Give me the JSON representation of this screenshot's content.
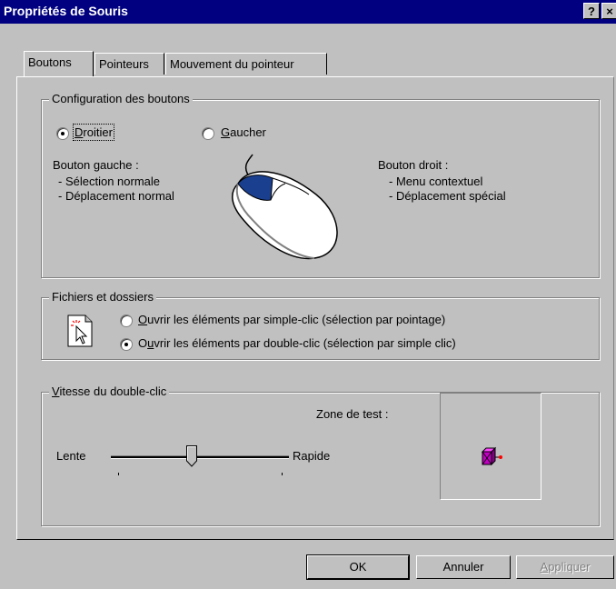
{
  "window": {
    "title": "Propriétés de Souris",
    "help_button": "?",
    "close_button": "×"
  },
  "tabs": [
    {
      "label": "Boutons",
      "active": true
    },
    {
      "label": "Pointeurs",
      "active": false
    },
    {
      "label": "Mouvement du pointeur",
      "active": false
    }
  ],
  "buttons_config": {
    "legend": "Configuration des boutons",
    "right_handed": {
      "prefix": "",
      "accel": "D",
      "rest": "roitier",
      "selected": true
    },
    "left_handed": {
      "prefix": "",
      "accel": "G",
      "rest": "aucher",
      "selected": false
    },
    "left_button": {
      "heading": "Bouton gauche :",
      "line1": "- Sélection normale",
      "line2": "- Déplacement normal"
    },
    "right_button": {
      "heading": "Bouton droit :",
      "line1": "- Menu contextuel",
      "line2": "- Déplacement spécial"
    },
    "mouse_icon": "mouse-icon"
  },
  "files_folders": {
    "legend": "Fichiers et dossiers",
    "icon": "pointer-click-icon",
    "single_click": {
      "accel": "O",
      "rest": "uvrir les éléments par simple-clic (sélection par pointage)",
      "selected": false
    },
    "double_click": {
      "prefix": "O",
      "accel": "u",
      "rest": "vrir les éléments par double-clic (sélection par simple clic)",
      "selected": true
    }
  },
  "double_click_speed": {
    "legend_accel": "V",
    "legend_rest": "itesse du double-clic",
    "test_area_label": "Zone de test :",
    "slow_label": "Lente",
    "fast_label": "Rapide",
    "slider_value": 0.45,
    "test_icon": "jack-in-the-box-icon",
    "test_icon_color": "#c000c0"
  },
  "footer": {
    "ok": "OK",
    "cancel": "Annuler",
    "apply": "Appliquer",
    "apply_enabled": false
  },
  "colors": {
    "title_bar": "#000080",
    "face": "#c0c0c0",
    "mouse_button": "#1a3f8f"
  }
}
